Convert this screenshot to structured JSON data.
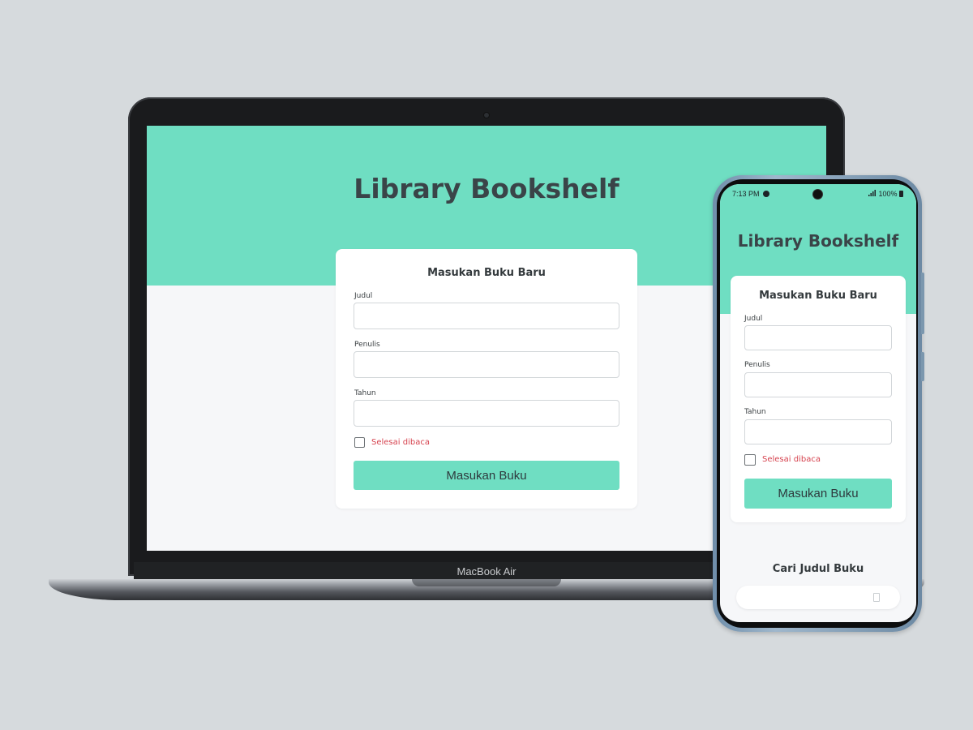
{
  "desktop": {
    "app_title": "Library Bookshelf",
    "form": {
      "heading": "Masukan Buku Baru",
      "title_label": "Judul",
      "title_value": "",
      "author_label": "Penulis",
      "author_value": "",
      "year_label": "Tahun",
      "year_value": "",
      "checkbox_label": "Selesai dibaca",
      "checkbox_checked": false,
      "submit_label": "Masukan Buku"
    },
    "device_label": "MacBook Air"
  },
  "mobile": {
    "status": {
      "time": "7:13 PM",
      "battery": "100%"
    },
    "app_title": "Library Bookshelf",
    "form": {
      "heading": "Masukan Buku Baru",
      "title_label": "Judul",
      "title_value": "",
      "author_label": "Penulis",
      "author_value": "",
      "year_label": "Tahun",
      "year_value": "",
      "checkbox_label": "Selesai dibaca",
      "checkbox_checked": false,
      "submit_label": "Masukan Buku"
    },
    "search": {
      "heading": "Cari Judul Buku",
      "value": ""
    }
  },
  "colors": {
    "accent": "#6fdec2",
    "heading_text": "#3a4448",
    "checkbox_label": "#d6434f",
    "page_background": "#f6f7f9",
    "stage_background": "#d6dadd"
  },
  "icons": [
    "camera-icon",
    "spotify-icon",
    "signal-icon",
    "battery-icon",
    "search-icon"
  ]
}
